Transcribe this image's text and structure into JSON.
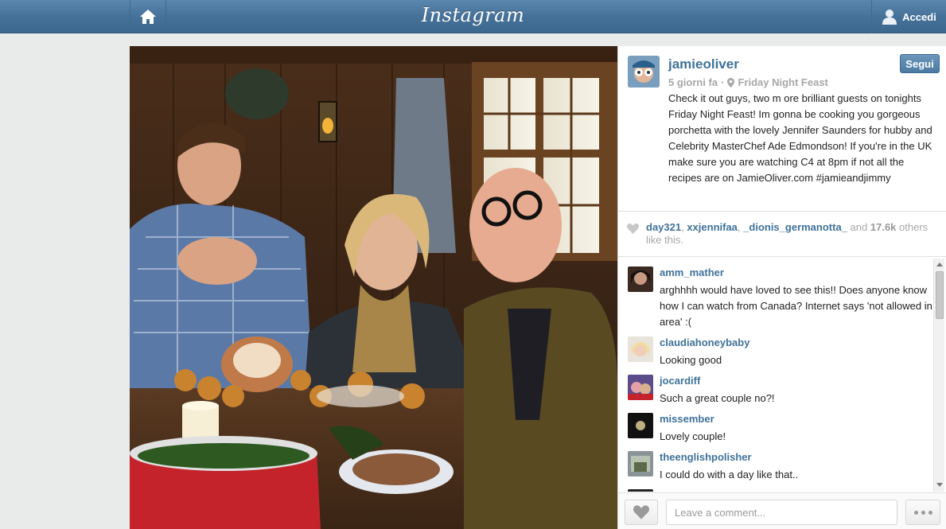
{
  "topbar": {
    "logo": "Instagram",
    "login_label": "Accedi",
    "home_icon": "home-icon",
    "user_icon": "user-icon"
  },
  "post": {
    "username": "jamieoliver",
    "follow_label": "Segui",
    "time": "5 giorni fa",
    "separator": "·",
    "location": "Friday Night Feast",
    "caption": "Check it out guys, two m ore brilliant guests on tonights Friday Night Feast! Im gonna be cooking you gorgeous porchetta with the lovely Jennifer Saunders for hubby and Celebrity MasterChef Ade Edmondson! If you're in the UK make sure you are watching C4 at 8pm if not all the recipes are on JamieOliver.com #jamieandjimmy"
  },
  "likes": {
    "users": [
      "day321",
      "xxjennifaa",
      "_dionis_germanotta_"
    ],
    "sep": ", ",
    "and_text": "and",
    "count": "17.6k",
    "others_text": "others like this."
  },
  "comments": [
    {
      "user": "amm_mather",
      "text": "arghhhh would have loved to see this!! Does anyone know how I can watch from Canada? Internet says 'not allowed in area' :("
    },
    {
      "user": "claudiahoneybaby",
      "text": "Looking good"
    },
    {
      "user": "jocardiff",
      "text": "Such a great couple no?!"
    },
    {
      "user": "missember",
      "text": "Lovely couple!"
    },
    {
      "user": "theenglishpolisher",
      "text": "I could do with a day like that.."
    }
  ],
  "footer": {
    "comment_placeholder": "Leave a comment..."
  },
  "colors": {
    "accent": "#3f729b",
    "topbar": "#46729a"
  }
}
